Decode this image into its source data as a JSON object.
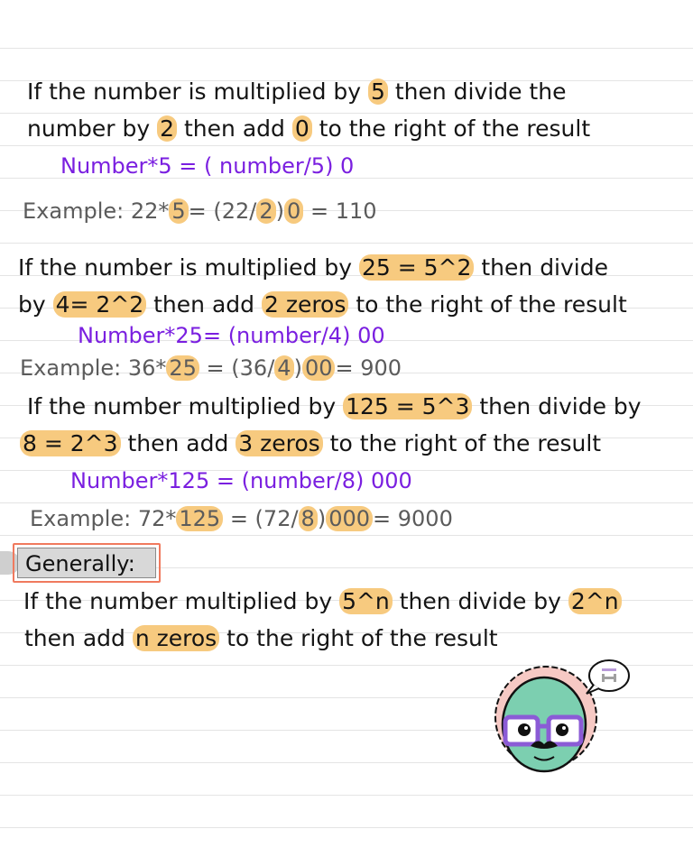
{
  "section1": {
    "line1": [
      "If the number is multiplied by ",
      "5",
      " then divide the"
    ],
    "line2": [
      "number by ",
      "2",
      " then add ",
      "0",
      " to the right of the result"
    ],
    "formula": "Number*5 = ( number/5) 0",
    "example": [
      "Example: 22*",
      "5",
      "= (22/",
      "2",
      ")",
      "0",
      " = 110"
    ]
  },
  "section2": {
    "line1": [
      "If the number is multiplied by ",
      "25 = 5^2",
      " then divide"
    ],
    "line2": [
      "by ",
      "4= 2^2",
      " then add ",
      "2 zeros",
      " to the right of the result"
    ],
    "formula": "Number*25= (number/4) 00",
    "example": [
      "Example: 36*",
      "25",
      " = (36/",
      "4",
      ")",
      "00",
      "= 900"
    ]
  },
  "section3": {
    "line1": [
      "If the number multiplied by ",
      "125 = 5^3",
      " then divide by"
    ],
    "line2": [
      "8 = 2^3",
      " then add ",
      "3 zeros",
      " to the right of the result"
    ],
    "formula": "Number*125 = (number/8) 000",
    "example": [
      "Example: 72*",
      "125",
      " = (72/",
      "8",
      ")",
      "000",
      "= 9000"
    ]
  },
  "general": {
    "heading": "Generally:",
    "line1": [
      "If the number multiplied by ",
      "5^n",
      " then divide by ",
      "2^n"
    ],
    "line2": [
      "then add ",
      "n zeros",
      " to the right of the result"
    ]
  },
  "colors": {
    "highlight": "#f7ca7f",
    "formula": "#7a1fe0",
    "example": "#5b5b5b",
    "heading_border": "#f07a5e"
  },
  "mascot": {
    "icon": "professor-avatar-icon",
    "bubble_icon": "speech-bubble-icon"
  }
}
